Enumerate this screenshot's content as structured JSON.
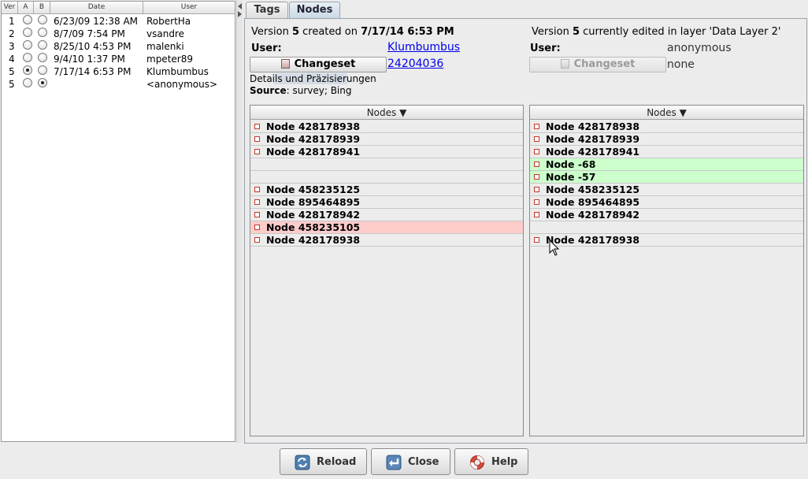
{
  "history": {
    "columns": [
      "Ver",
      "A",
      "B",
      "Date",
      "User"
    ],
    "rows": [
      {
        "ver": "1",
        "a": false,
        "b": false,
        "date": "6/23/09 12:38 AM",
        "user": "RobertHa"
      },
      {
        "ver": "2",
        "a": false,
        "b": false,
        "date": "8/7/09 7:54 PM",
        "user": "vsandre"
      },
      {
        "ver": "3",
        "a": false,
        "b": false,
        "date": "8/25/10 4:53 PM",
        "user": "malenki"
      },
      {
        "ver": "4",
        "a": false,
        "b": false,
        "date": "9/4/10 1:37 PM",
        "user": "mpeter89"
      },
      {
        "ver": "5",
        "a": true,
        "b": false,
        "date": "7/17/14 6:53 PM",
        "user": "Klumbumbus"
      },
      {
        "ver": "5",
        "a": false,
        "b": true,
        "date": "",
        "user": "<anonymous>"
      }
    ]
  },
  "tabs": [
    {
      "label": "Tags",
      "active": false
    },
    {
      "label": "Nodes",
      "active": true
    }
  ],
  "left_version": {
    "prefix": "Version ",
    "version": "5",
    "middle": " created on ",
    "date": "7/17/14 6:53 PM",
    "user_label": "User:",
    "user_value": "Klumbumbus",
    "changeset_label": "Changeset",
    "changeset_value": "24204036",
    "comment": "Details und Präzisierungen",
    "source_label": "Source",
    "source_value": ": survey; Bing"
  },
  "right_version": {
    "prefix": "Version ",
    "version": "5",
    "suffix": " currently edited in layer 'Data Layer 2'",
    "user_label": "User:",
    "user_value": "anonymous",
    "changeset_label": "Changeset",
    "changeset_value": "none"
  },
  "left_nodes": {
    "header": "Nodes ▼",
    "rows": [
      {
        "label": "Node 428178938",
        "state": "normal"
      },
      {
        "label": "Node 428178939",
        "state": "normal"
      },
      {
        "label": "Node 428178941",
        "state": "normal"
      },
      {
        "label": "",
        "state": "empty"
      },
      {
        "label": "",
        "state": "empty"
      },
      {
        "label": "Node 458235125",
        "state": "normal"
      },
      {
        "label": "Node 895464895",
        "state": "normal"
      },
      {
        "label": "Node 428178942",
        "state": "normal"
      },
      {
        "label": "Node 458235105",
        "state": "removed"
      },
      {
        "label": "Node 428178938",
        "state": "normal"
      }
    ]
  },
  "right_nodes": {
    "header": "Nodes ▼",
    "rows": [
      {
        "label": "Node 428178938",
        "state": "normal"
      },
      {
        "label": "Node 428178939",
        "state": "normal"
      },
      {
        "label": "Node 428178941",
        "state": "normal"
      },
      {
        "label": "Node -68",
        "state": "added"
      },
      {
        "label": "Node -57",
        "state": "added"
      },
      {
        "label": "Node 458235125",
        "state": "normal"
      },
      {
        "label": "Node 895464895",
        "state": "normal"
      },
      {
        "label": "Node 428178942",
        "state": "normal"
      },
      {
        "label": "",
        "state": "empty"
      },
      {
        "label": "Node 428178938",
        "state": "normal"
      }
    ]
  },
  "buttons": {
    "reload": "Reload",
    "close": "Close",
    "help": "Help"
  },
  "colors": {
    "added_row": "#ccffcc",
    "removed_row": "#ffcccc",
    "link": "#0000ee"
  }
}
